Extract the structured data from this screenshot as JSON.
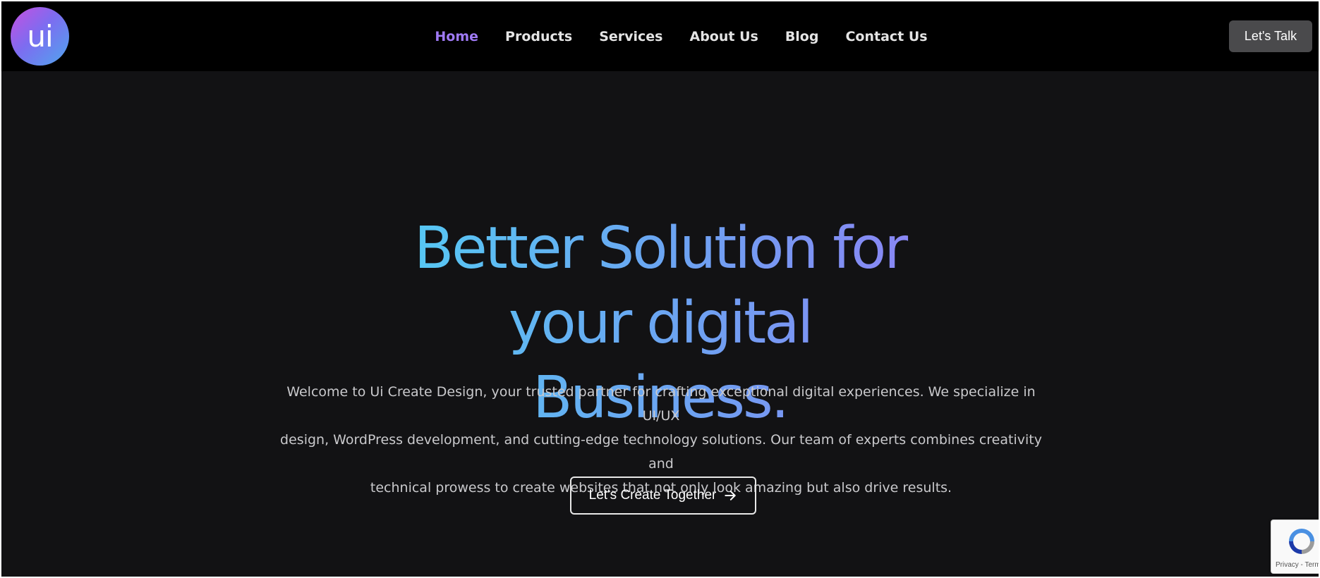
{
  "header": {
    "logo_text": "ui",
    "nav": [
      {
        "label": "Home",
        "active": true
      },
      {
        "label": "Products",
        "active": false
      },
      {
        "label": "Services",
        "active": false
      },
      {
        "label": "About Us",
        "active": false
      },
      {
        "label": "Blog",
        "active": false
      },
      {
        "label": "Contact Us",
        "active": false
      }
    ],
    "cta_label": "Let's Talk"
  },
  "hero": {
    "title_line1": "Better Solution for",
    "title_line2": "your digital Business.",
    "description_line1": "Welcome to Ui Create Design, your trusted partner for crafting exceptional digital experiences. We specialize in UI/UX",
    "description_line2": "design, WordPress development, and cutting-edge technology solutions. Our team of experts combines creativity and",
    "description_line3": "technical prowess to create websites that not only look amazing but also drive results.",
    "cta_label": "Let's Create Together"
  },
  "recaptcha": {
    "links": "Privacy - Terms"
  },
  "colors": {
    "background": "#121214",
    "header_bg": "#000000",
    "nav_active": "#9f7af5",
    "title_gradient_start": "#56c8f3",
    "title_gradient_end": "#8a86f4"
  },
  "icons": {
    "cta_icon": "arrow-right-icon",
    "recaptcha_icon": "recaptcha-icon"
  }
}
